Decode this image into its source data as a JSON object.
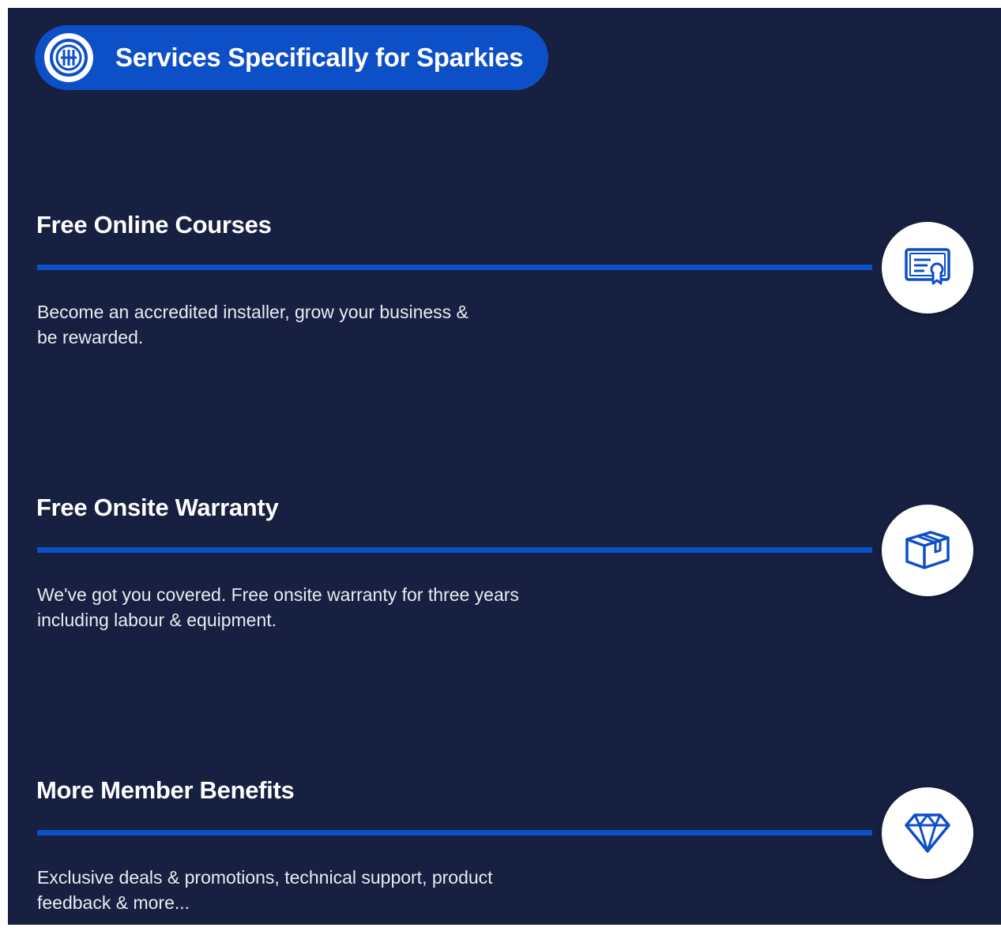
{
  "header": {
    "title": "Services Specifically for Sparkies",
    "logo_icon": "brand-logo-icon"
  },
  "colors": {
    "background": "#172040",
    "accent": "#0d4fc7",
    "text": "#ffffff"
  },
  "services": [
    {
      "title": "Free Online Courses",
      "description": "Become an accredited installer, grow your business &\nbe rewarded.",
      "icon": "certificate-icon"
    },
    {
      "title": "Free Onsite Warranty",
      "description": "We've got you covered. Free onsite warranty for three years\nincluding labour & equipment.",
      "icon": "box-icon"
    },
    {
      "title": "More Member Benefits",
      "description": "Exclusive deals & promotions, technical support, product\nfeedback & more...",
      "icon": "diamond-icon"
    }
  ]
}
